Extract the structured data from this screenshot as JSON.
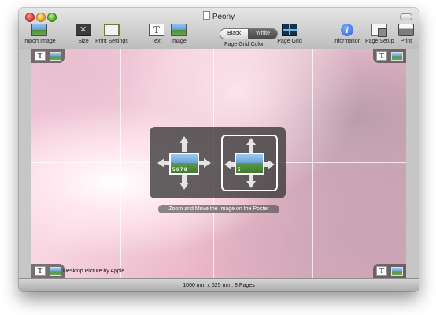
{
  "window": {
    "title": "Peony"
  },
  "toolbar": {
    "import_image": "Import Image",
    "size": "Size",
    "print_settings": "Print Settings",
    "text": "Text",
    "image": "Image",
    "page_grid_color": "Page Grid Color",
    "segment_black": "Black",
    "segment_white": "White",
    "segment_selected": "White",
    "page_grid": "Page Grid",
    "information": "Information",
    "page_setup": "Page Setup",
    "print": "Print"
  },
  "canvas": {
    "caption": "Desktop Picture by Apple.",
    "hint": "Zoom and Move the Image on the Poster",
    "thumb_numbers_a": "5 6  7  8",
    "thumb_numbers_b": "5"
  },
  "status": {
    "text": "1000 mm  x  625 mm, 8 Pages"
  },
  "icons": {
    "import_image": "photo-icon",
    "size": "size-icon",
    "print_settings": "print-settings-icon",
    "text": "text-icon",
    "image": "image-icon",
    "page_grid": "page-grid-icon",
    "information": "info-icon",
    "page_setup": "page-setup-icon",
    "print": "printer-icon"
  },
  "colors": {
    "accent_blue": "#2e5fd8"
  }
}
